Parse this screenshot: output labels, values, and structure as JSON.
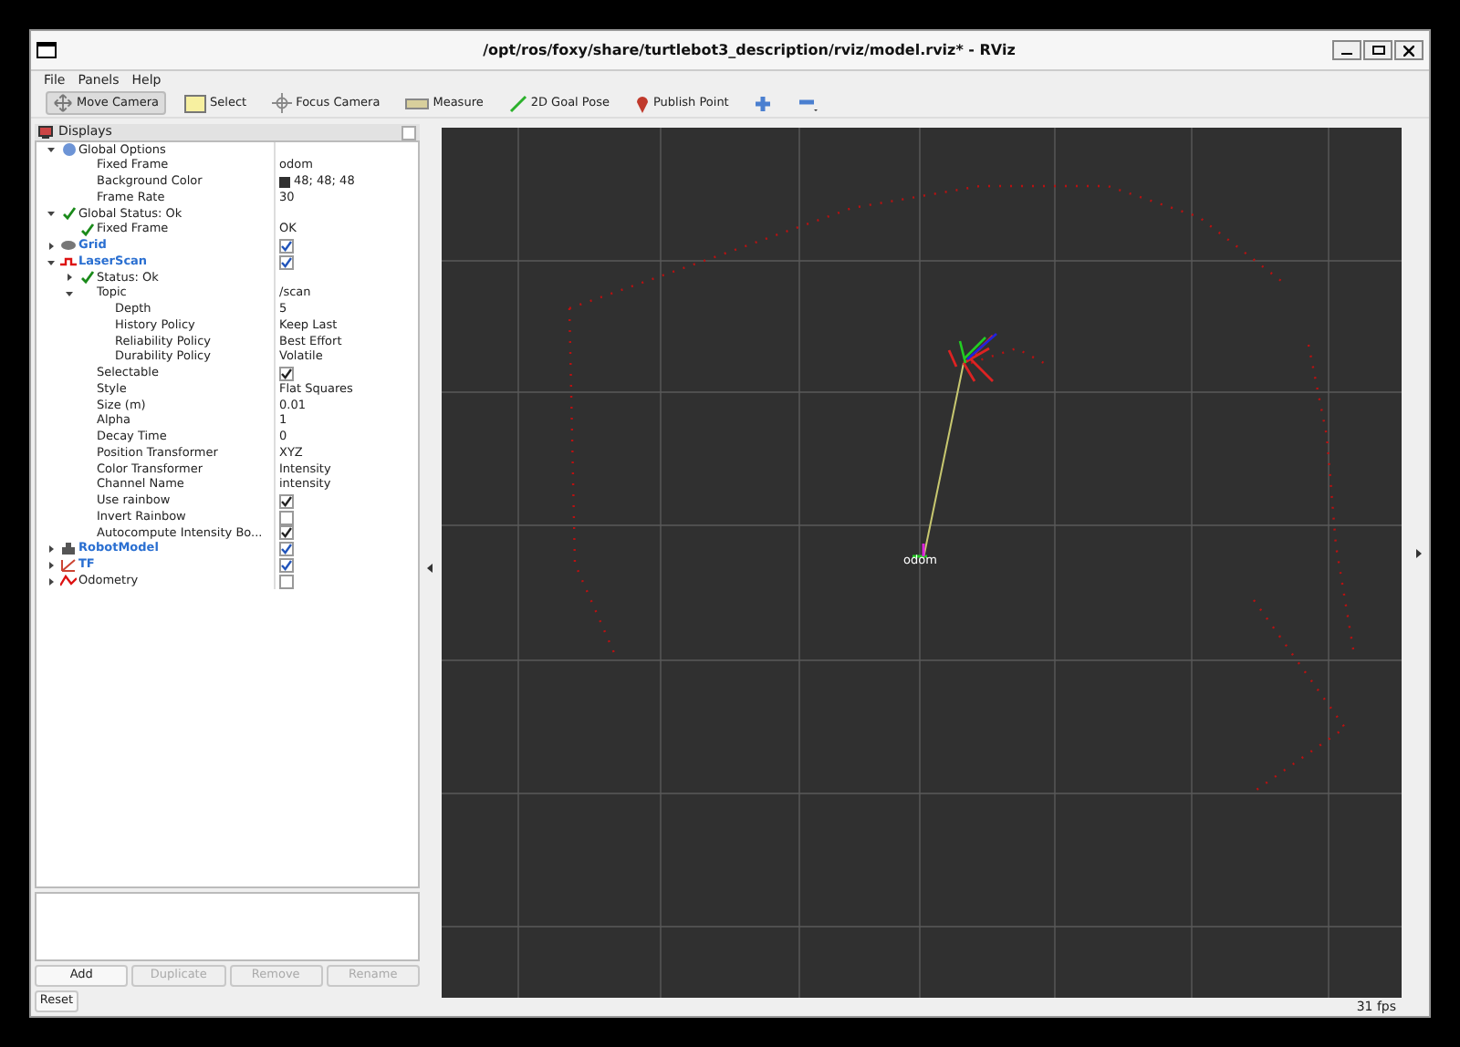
{
  "window": {
    "title": "/opt/ros/foxy/share/turtlebot3_description/rviz/model.rviz* - RViz"
  },
  "menu": [
    "File",
    "Panels",
    "Help"
  ],
  "toolbar": [
    {
      "label": "Move Camera",
      "kind": "move",
      "selected": true
    },
    {
      "label": "Select",
      "kind": "select",
      "selected": false
    },
    {
      "label": "Focus Camera",
      "kind": "focus",
      "selected": false
    },
    {
      "label": "Measure",
      "kind": "measure",
      "selected": false
    },
    {
      "label": "2D Goal Pose",
      "kind": "goal",
      "selected": false
    },
    {
      "label": "Publish Point",
      "kind": "point",
      "selected": false
    },
    {
      "kind": "plus",
      "selected": false
    },
    {
      "kind": "minus",
      "selected": false
    }
  ],
  "displays": {
    "title": "Displays",
    "tree": [
      {
        "label": "Global Options",
        "kind": "options",
        "expanded": true,
        "children": [
          {
            "label": "Fixed Frame",
            "value": "odom"
          },
          {
            "label": "Background Color",
            "value": "48; 48; 48",
            "color": "#303030"
          },
          {
            "label": "Frame Rate",
            "value": "30"
          }
        ]
      },
      {
        "label": "Global Status: Ok",
        "kind": "check",
        "expanded": true,
        "children": [
          {
            "label": "Fixed Frame",
            "kind": "check",
            "value": "OK"
          }
        ]
      },
      {
        "label": "Grid",
        "kind": "grid",
        "link": true,
        "expanded": false,
        "checked": true
      },
      {
        "label": "LaserScan",
        "kind": "laser",
        "link": true,
        "expanded": true,
        "checked": true,
        "children": [
          {
            "label": "Status: Ok",
            "kind": "check",
            "expanded": false
          },
          {
            "label": "Topic",
            "value": "/scan",
            "expanded": true,
            "children": [
              {
                "label": "Depth",
                "value": "5"
              },
              {
                "label": "History Policy",
                "value": "Keep Last"
              },
              {
                "label": "Reliability Policy",
                "value": "Best Effort"
              },
              {
                "label": "Durability Policy",
                "value": "Volatile"
              }
            ]
          },
          {
            "label": "Selectable",
            "checked": true
          },
          {
            "label": "Style",
            "value": "Flat Squares"
          },
          {
            "label": "Size (m)",
            "value": "0.01"
          },
          {
            "label": "Alpha",
            "value": "1"
          },
          {
            "label": "Decay Time",
            "value": "0"
          },
          {
            "label": "Position Transformer",
            "value": "XYZ"
          },
          {
            "label": "Color Transformer",
            "value": "Intensity"
          },
          {
            "label": "Channel Name",
            "value": "intensity"
          },
          {
            "label": "Use rainbow",
            "checked": true
          },
          {
            "label": "Invert Rainbow",
            "checked": false
          },
          {
            "label": "Autocompute Intensity Bo...",
            "checked": true
          }
        ]
      },
      {
        "label": "RobotModel",
        "kind": "robot",
        "link": true,
        "expanded": false,
        "checked": true
      },
      {
        "label": "TF",
        "kind": "tf",
        "link": true,
        "expanded": false,
        "checked": true
      },
      {
        "label": "Odometry",
        "kind": "odometry",
        "link": false,
        "expanded": false,
        "checked": false
      }
    ]
  },
  "buttons": [
    {
      "label": "Add",
      "disabled": false
    },
    {
      "label": "Duplicate",
      "disabled": true
    },
    {
      "label": "Remove",
      "disabled": true
    },
    {
      "label": "Rename",
      "disabled": true
    }
  ],
  "reset": "Reset",
  "viewport": {
    "frame_label": "odom"
  },
  "status_bar": {
    "fps": "31 fps"
  }
}
